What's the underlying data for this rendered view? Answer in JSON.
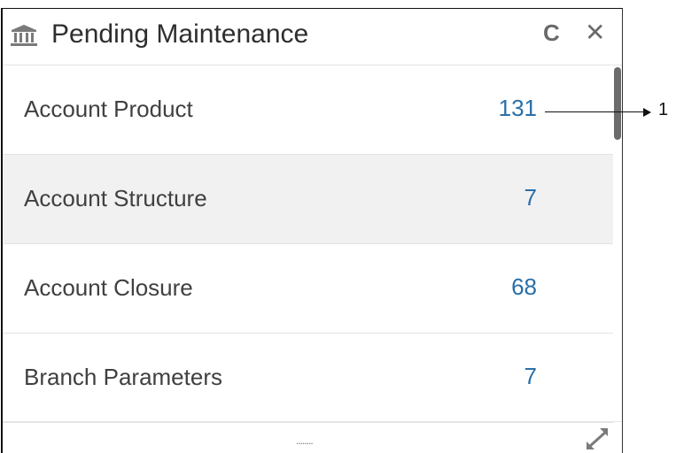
{
  "widget": {
    "title": "Pending Maintenance",
    "title_icon": "bank-icon",
    "refresh_icon": "refresh-icon",
    "close_icon": "close-icon",
    "refresh_glyph": "C",
    "close_glyph": "✕"
  },
  "items": [
    {
      "label": "Account Product",
      "count": "131"
    },
    {
      "label": "Account Structure",
      "count": "7"
    },
    {
      "label": "Account Closure",
      "count": "68"
    },
    {
      "label": "Branch Parameters",
      "count": "7"
    }
  ],
  "footer": {
    "drag_handle": "........",
    "expand_icon": "expand-icon"
  },
  "annotation": {
    "callout_number": "1"
  },
  "colors": {
    "count_text": "#2a6fa8",
    "highlight_row": "#f1f1f1",
    "icon_gray": "#6a6a6a"
  }
}
